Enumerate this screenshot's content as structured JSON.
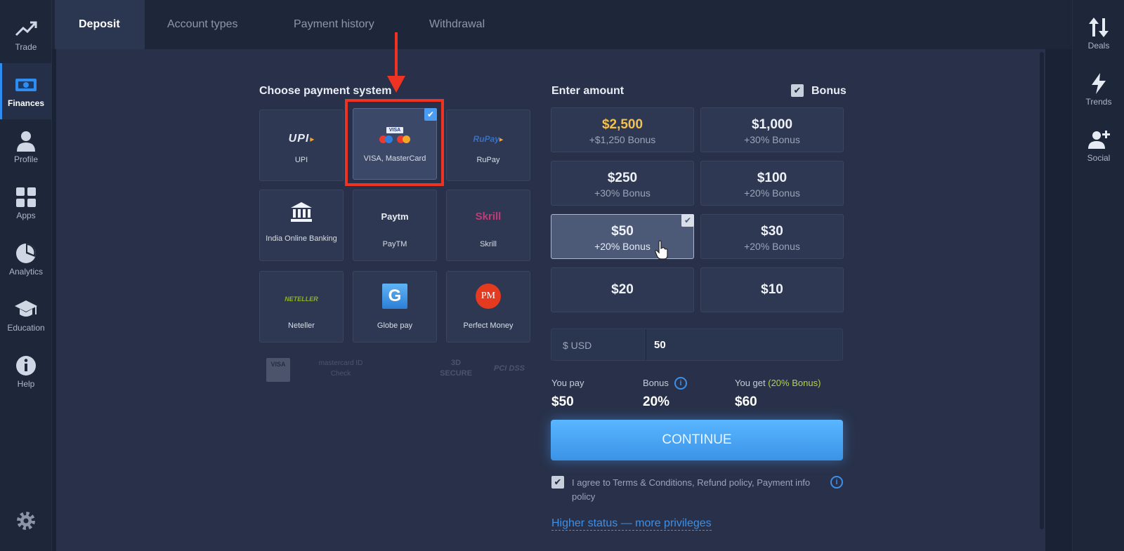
{
  "sidebar_left": {
    "items": [
      {
        "label": "Trade",
        "icon": "trade-chart-icon"
      },
      {
        "label": "Finances",
        "icon": "finances-money-icon",
        "active": true
      },
      {
        "label": "Profile",
        "icon": "profile-person-icon"
      },
      {
        "label": "Apps",
        "icon": "apps-grid-icon"
      },
      {
        "label": "Analytics",
        "icon": "analytics-pie-icon"
      },
      {
        "label": "Education",
        "icon": "education-cap-icon"
      },
      {
        "label": "Help",
        "icon": "help-info-icon"
      }
    ],
    "settings_icon": "gear-icon"
  },
  "sidebar_right": {
    "items": [
      {
        "label": "Deals",
        "icon": "deals-arrows-icon"
      },
      {
        "label": "Trends",
        "icon": "trends-lightning-icon"
      },
      {
        "label": "Social",
        "icon": "social-add-user-icon"
      }
    ]
  },
  "tabs": [
    {
      "label": "Deposit",
      "active": true
    },
    {
      "label": "Account types"
    },
    {
      "label": "Payment history"
    },
    {
      "label": "Withdrawal"
    }
  ],
  "payment": {
    "title": "Choose payment system",
    "methods": [
      {
        "label": "UPI",
        "logo_text": "UPI"
      },
      {
        "label": "VISA, MasterCard",
        "logo_text": "VISA",
        "selected": true
      },
      {
        "label": "RuPay",
        "logo_text": "RuPay"
      },
      {
        "label": "India Online Banking"
      },
      {
        "label": "PayTM",
        "logo_text": "Paytm"
      },
      {
        "label": "Skrill",
        "logo_text": "Skrill"
      },
      {
        "label": "Neteller",
        "logo_text": "NETELLER"
      },
      {
        "label": "Globe pay",
        "logo_text": "G"
      },
      {
        "label": "Perfect Money",
        "logo_text": "PM"
      }
    ],
    "security_logos": [
      "VISA",
      "mastercard ID Check",
      "3D SECURE",
      "PCI DSS"
    ]
  },
  "amount": {
    "title": "Enter amount",
    "bonus_label": "Bonus",
    "bonus_checked": true,
    "options": [
      {
        "amount": "$2,500",
        "bonus": "+$1,250 Bonus",
        "gold": true
      },
      {
        "amount": "$1,000",
        "bonus": "+30% Bonus"
      },
      {
        "amount": "$250",
        "bonus": "+30% Bonus"
      },
      {
        "amount": "$100",
        "bonus": "+20% Bonus"
      },
      {
        "amount": "$50",
        "bonus": "+20% Bonus",
        "selected": true
      },
      {
        "amount": "$30",
        "bonus": "+20% Bonus"
      },
      {
        "amount": "$20",
        "bonus": ""
      },
      {
        "amount": "$10",
        "bonus": ""
      }
    ],
    "currency_label": "$ USD",
    "input_value": "50"
  },
  "summary": {
    "you_pay_label": "You pay",
    "you_pay_value": "$50",
    "bonus_label": "Bonus",
    "bonus_value": "20%",
    "you_get_label": "You get",
    "you_get_note": "(20% Bonus)",
    "you_get_value": "$60"
  },
  "continue_label": "CONTINUE",
  "terms": {
    "text_line1": "I agree to Terms & Conditions, Refund policy, Payment info",
    "text_line2": "policy",
    "checked": true
  },
  "status_link": "Higher status — more privileges",
  "colors": {
    "accent": "#3e8fe6",
    "highlight": "#ee3322",
    "gold": "#f2c152",
    "bonus_note": "#b6d24a"
  }
}
